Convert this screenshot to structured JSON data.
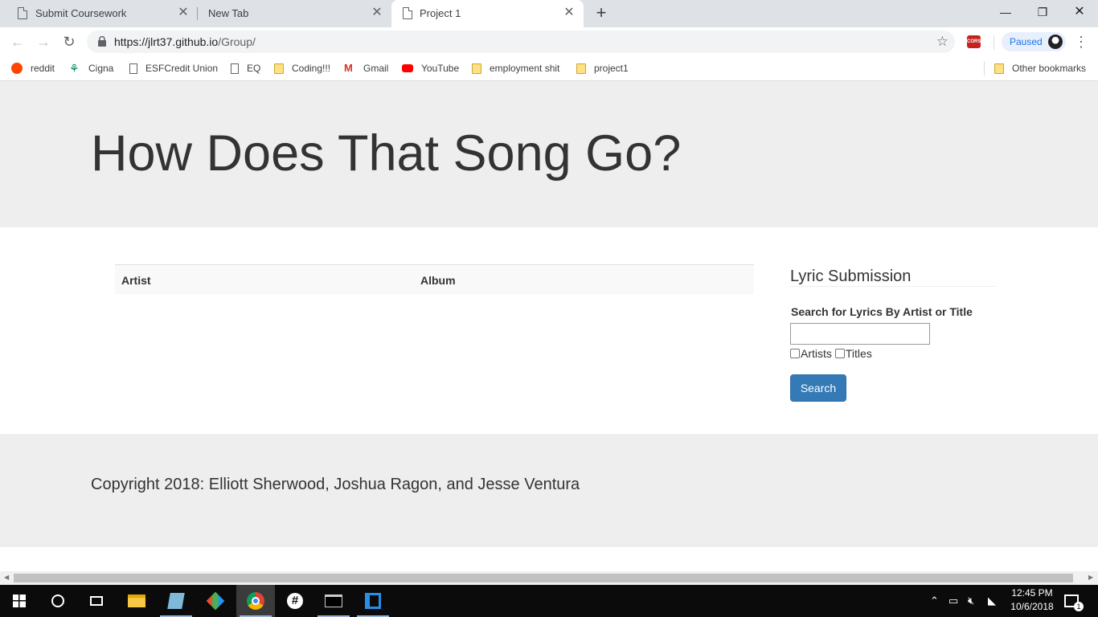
{
  "browser": {
    "tabs": [
      {
        "title": "Submit Coursework",
        "active": false
      },
      {
        "title": "New Tab",
        "active": false
      },
      {
        "title": "Project 1",
        "active": true
      }
    ],
    "new_tab_glyph": "+",
    "close_glyph": "✕",
    "url_host": "https://jlrt37.github.io",
    "url_path": "/Group/",
    "extension_label": "CORS",
    "profile_status": "Paused",
    "bookmarks": [
      {
        "label": "reddit",
        "icon": "reddit-icon"
      },
      {
        "label": "Cigna",
        "icon": "cigna-icon"
      },
      {
        "label": "ESFCredit Union",
        "icon": "page-icon"
      },
      {
        "label": "EQ",
        "icon": "page-icon"
      },
      {
        "label": "Coding!!!",
        "icon": "folder-icon"
      },
      {
        "label": "Gmail",
        "icon": "gmail-icon"
      },
      {
        "label": "YouTube",
        "icon": "youtube-icon"
      },
      {
        "label": "employment shit",
        "icon": "folder-icon"
      },
      {
        "label": "project1",
        "icon": "folder-icon"
      }
    ],
    "other_bookmarks": "Other bookmarks"
  },
  "page": {
    "heading": "How Does That Song Go?",
    "table": {
      "columns": [
        "Artist",
        "Album"
      ]
    },
    "panel": {
      "title": "Lyric Submission",
      "search_label": "Search for Lyrics By Artist or Title",
      "search_value": "",
      "checkbox_artists": "Artists",
      "checkbox_titles": "Titles",
      "search_button": "Search"
    },
    "footer": "Copyright 2018: Elliott Sherwood, Joshua Ragon, and Jesse Ventura"
  },
  "taskbar": {
    "time": "12:45 PM",
    "date": "10/6/2018",
    "notification_count": "1",
    "apps": [
      "start",
      "cortana",
      "task-view",
      "file-explorer",
      "notepad",
      "git",
      "chrome",
      "slack",
      "terminal",
      "vscode"
    ]
  },
  "colors": {
    "primary_button": "#337ab7",
    "jumbotron_bg": "#eeeeee",
    "tab_strip_bg": "#dee1e6"
  }
}
